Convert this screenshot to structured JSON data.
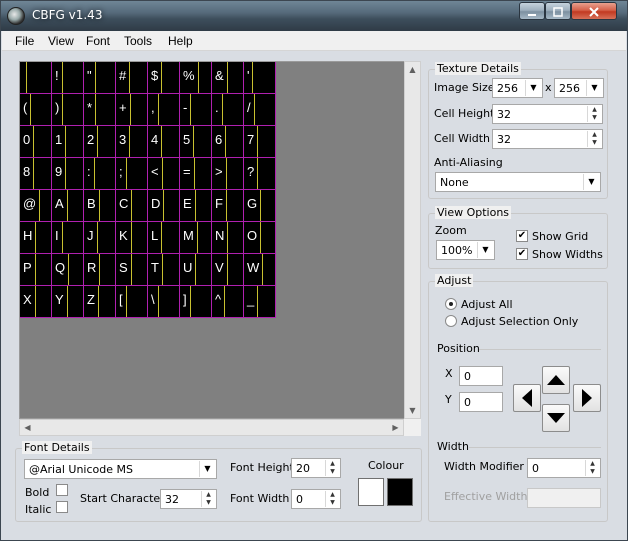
{
  "window": {
    "title": "CBFG v1.43"
  },
  "menu": [
    "File",
    "View",
    "Font",
    "Tools",
    "Help"
  ],
  "texture": {
    "rows": [
      [
        " ",
        "!",
        "\"",
        "#",
        "$",
        "%",
        "&",
        "'"
      ],
      [
        "(",
        ")",
        "*",
        "+",
        ",",
        "-",
        ".",
        "/"
      ],
      [
        "0",
        "1",
        "2",
        "3",
        "4",
        "5",
        "6",
        "7"
      ],
      [
        "8",
        "9",
        ":",
        ";",
        "<",
        "=",
        ">",
        "?"
      ],
      [
        "@",
        "A",
        "B",
        "C",
        "D",
        "E",
        "F",
        "G"
      ],
      [
        "H",
        "I",
        "J",
        "K",
        "L",
        "M",
        "N",
        "O"
      ],
      [
        "P",
        "Q",
        "R",
        "S",
        "T",
        "U",
        "V",
        "W"
      ],
      [
        "X",
        "Y",
        "Z",
        "[",
        "\\",
        "]",
        "^",
        "_"
      ]
    ],
    "grid_color": "#b020b0",
    "width_line_color": "#c8c030",
    "background": "#000000"
  },
  "texture_details": {
    "title": "Texture Details",
    "image_size_label": "Image Size",
    "image_width": "256",
    "x_sep": "x",
    "image_height": "256",
    "cell_height_label": "Cell Height",
    "cell_height": "32",
    "cell_width_label": "Cell Width",
    "cell_width": "32",
    "anti_aliasing_label": "Anti-Aliasing",
    "anti_aliasing": "None"
  },
  "view_options": {
    "title": "View Options",
    "zoom_label": "Zoom",
    "zoom": "100%",
    "show_grid_label": "Show Grid",
    "show_grid": true,
    "show_widths_label": "Show Widths",
    "show_widths": true
  },
  "adjust": {
    "title": "Adjust",
    "adjust_all_label": "Adjust All",
    "adjust_selection_label": "Adjust Selection Only",
    "position_label": "Position",
    "x_label": "X",
    "x_value": "0",
    "y_label": "Y",
    "y_value": "0",
    "width_label": "Width",
    "width_modifier_label": "Width Modifier",
    "width_modifier": "0",
    "effective_width_label": "Effective Width",
    "effective_width": ""
  },
  "font_details": {
    "title": "Font Details",
    "font_name": "@Arial Unicode MS",
    "font_height_label": "Font Height",
    "font_height": "20",
    "colour_label": "Colour",
    "bold_label": "Bold",
    "italic_label": "Italic",
    "start_char_label": "Start Character",
    "start_char": "32",
    "font_width_label": "Font Width",
    "font_width": "0",
    "colour_fg": "#ffffff",
    "colour_bg": "#000000"
  }
}
